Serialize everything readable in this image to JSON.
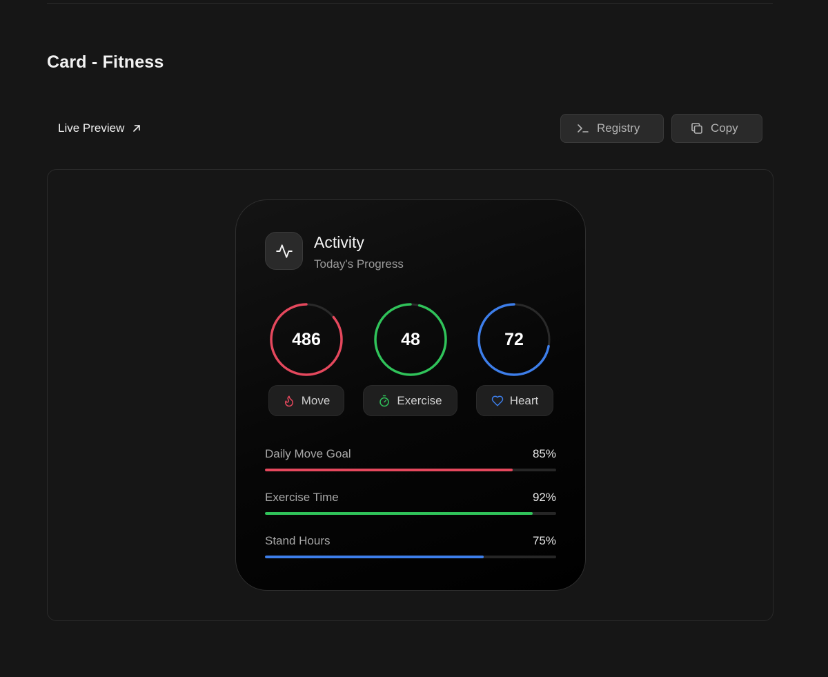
{
  "page": {
    "title": "Card - Fitness"
  },
  "toolbar": {
    "live_preview_label": "Live Preview",
    "registry_label": "Registry",
    "copy_label": "Copy"
  },
  "card": {
    "title": "Activity",
    "subtitle": "Today's Progress",
    "rings": [
      {
        "value": "486",
        "label": "Move",
        "color": "#e5485d",
        "progress": 0.86,
        "icon": "flame-icon"
      },
      {
        "value": "48",
        "label": "Exercise",
        "color": "#30c35a",
        "progress": 0.96,
        "icon": "stopwatch-icon"
      },
      {
        "value": "72",
        "label": "Heart",
        "color": "#3d7eea",
        "progress": 0.72,
        "icon": "heart-icon"
      }
    ],
    "stats": [
      {
        "label": "Daily Move Goal",
        "percent_text": "85%",
        "progress": 0.85,
        "color": "#e5485d"
      },
      {
        "label": "Exercise Time",
        "percent_text": "92%",
        "progress": 0.92,
        "color": "#30c35a"
      },
      {
        "label": "Stand Hours",
        "percent_text": "75%",
        "progress": 0.75,
        "color": "#3d7eea"
      }
    ]
  },
  "colors": {
    "background": "#161616",
    "card_background": "#000000",
    "track": "#262626"
  }
}
